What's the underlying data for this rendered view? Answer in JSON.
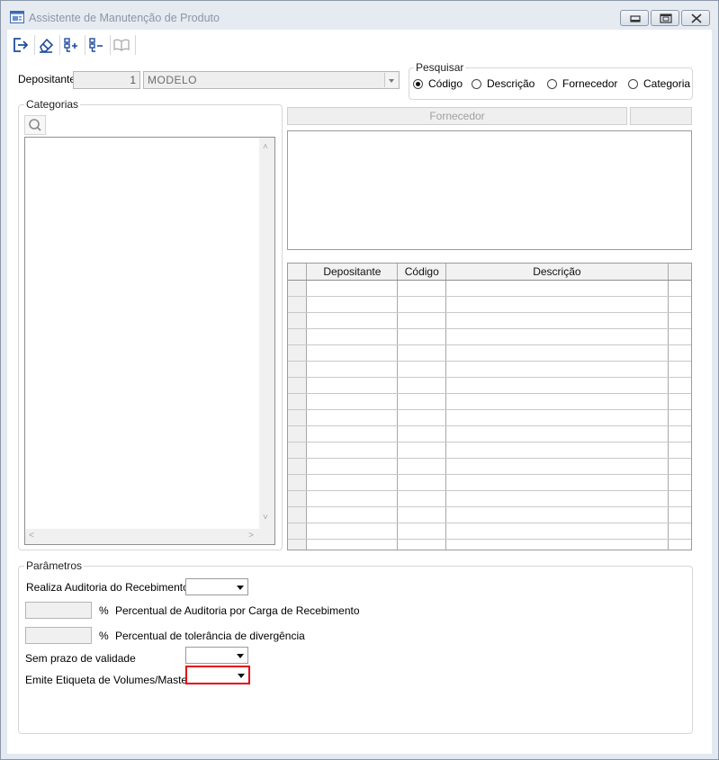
{
  "window": {
    "title": "Assistente de Manutenção de Produto"
  },
  "toolbar": {
    "buttons": [
      {
        "icon": "exit-icon"
      },
      {
        "icon": "eraser-icon"
      },
      {
        "icon": "add-list-icon"
      },
      {
        "icon": "remove-list-icon"
      },
      {
        "icon": "book-icon"
      }
    ]
  },
  "depositante": {
    "label": "Depositante",
    "code": "1",
    "name": "MODELO"
  },
  "pesquisar": {
    "caption": "Pesquisar",
    "options": [
      "Código",
      "Descrição",
      "Fornecedor",
      "Categoria"
    ],
    "selected": "Código"
  },
  "categorias": {
    "caption": "Categorias"
  },
  "fornecedor": {
    "header": "Fornecedor"
  },
  "grid": {
    "columns": [
      "Depositante",
      "Código",
      "Descrição"
    ],
    "row_count": 17
  },
  "parametros": {
    "caption": "Parâmetros",
    "realiza_auditoria": "Realiza Auditoria do Recebimento",
    "percent_symbol": "%",
    "percentual_auditoria": "Percentual de Auditoria por Carga de Recebimento",
    "percentual_tolerancia": "Percentual de tolerância de divergência",
    "sem_prazo": "Sem prazo de validade",
    "emite_etiqueta": "Emite Etiqueta de Volumes/Master"
  },
  "colors": {
    "highlight": "#e30613",
    "window_frame": "#e3e9f1",
    "toolbar_icon": "#1f4e9c"
  }
}
